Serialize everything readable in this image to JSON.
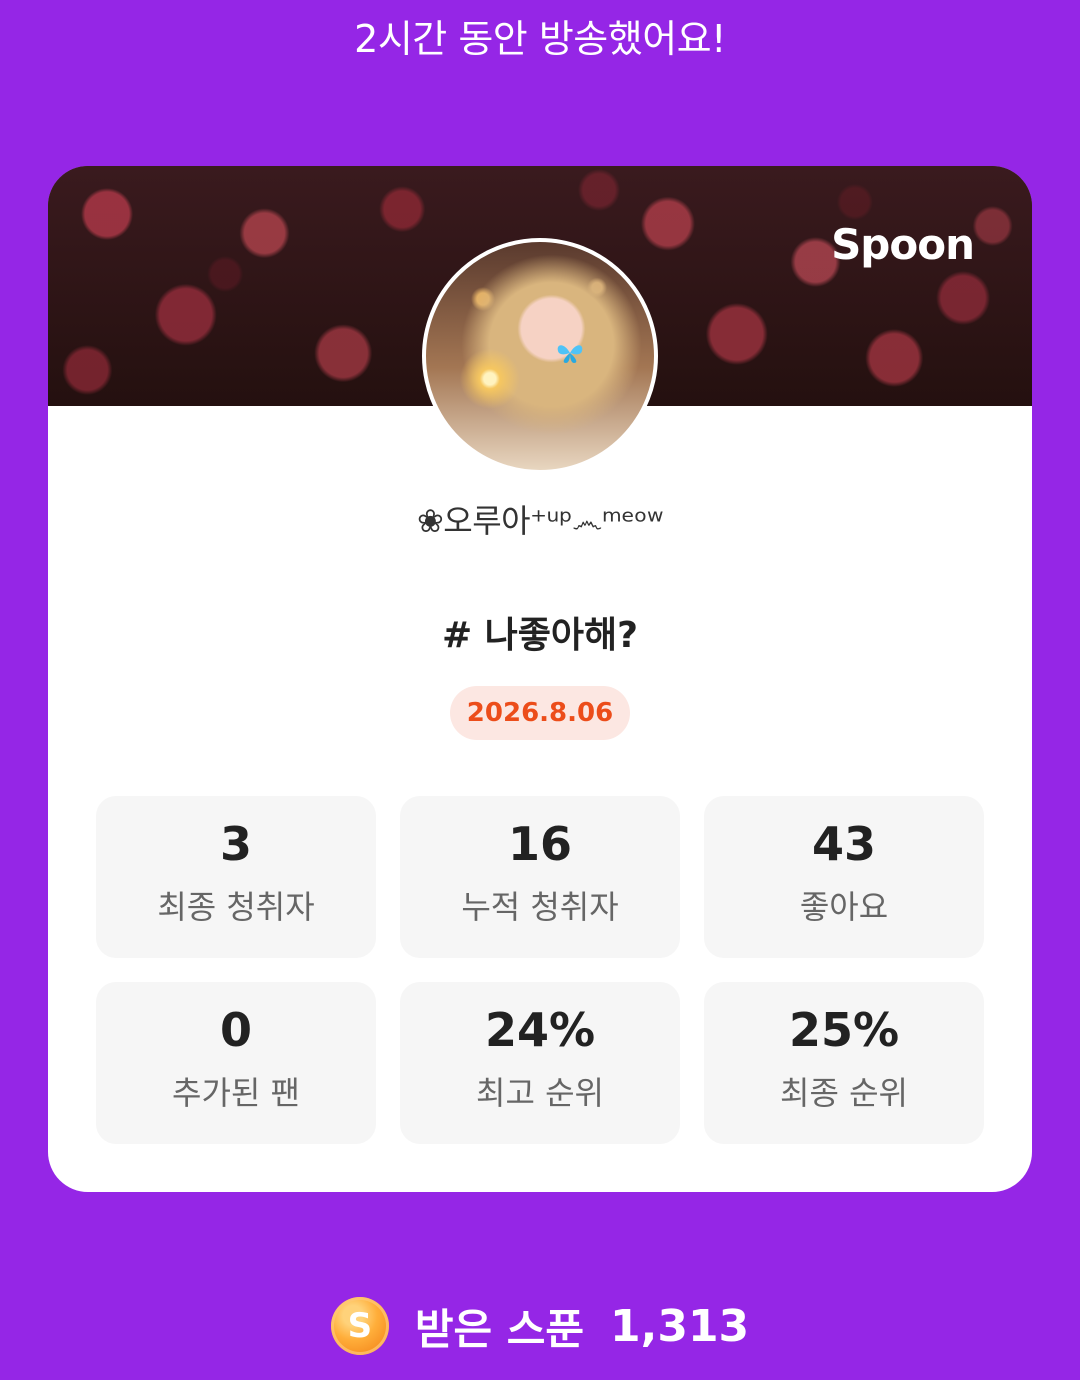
{
  "headline": "2시간 동안 방송했어요!",
  "brand": "Spoon",
  "host": {
    "name": "❀오루아⁺ᵘᵖ෴ᵐᵉᵒʷ"
  },
  "topic": "# 나좋아해?",
  "date": "2026.8.06",
  "stats": [
    {
      "value": "3",
      "label": "최종 청취자"
    },
    {
      "value": "16",
      "label": "누적 청취자"
    },
    {
      "value": "43",
      "label": "좋아요"
    },
    {
      "value": "0",
      "label": "추가된 팬"
    },
    {
      "value": "24%",
      "label": "최고 순위"
    },
    {
      "value": "25%",
      "label": "최종 순위"
    }
  ],
  "received": {
    "coin_symbol": "S",
    "label": "받은 스푼",
    "amount": "1,313"
  },
  "colors": {
    "background": "#9526e6",
    "date_accent": "#ec4d1a",
    "date_bg": "#fce7e2"
  }
}
